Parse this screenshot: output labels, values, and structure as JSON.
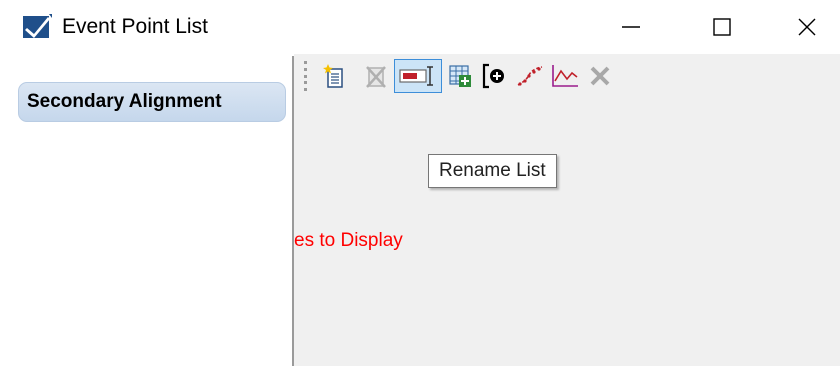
{
  "window": {
    "title": "Event Point List",
    "controls": {
      "minimize_icon": "minimize-icon",
      "maximize_icon": "maximize-icon",
      "close_icon": "close-icon"
    }
  },
  "sidebar": {
    "items": [
      {
        "label": "Secondary Alignment",
        "selected": true
      }
    ]
  },
  "toolbar": {
    "buttons": [
      {
        "icon": "new-list-icon",
        "enabled": true
      },
      {
        "icon": "delete-list-icon",
        "enabled": false
      },
      {
        "icon": "rename-list-icon",
        "enabled": true,
        "active": true
      },
      {
        "icon": "table-add-icon",
        "enabled": true
      },
      {
        "icon": "add-point-icon",
        "enabled": true
      },
      {
        "icon": "points-along-icon",
        "enabled": true
      },
      {
        "icon": "profile-icon",
        "enabled": true
      },
      {
        "icon": "delete-icon",
        "enabled": false
      }
    ]
  },
  "tooltip": {
    "text": "Rename List"
  },
  "main": {
    "message": "es to Display",
    "message_color": "#ff0000"
  },
  "colors": {
    "accent": "#3d8ed9",
    "sidebar_tab": "#c5d7ec",
    "content_bg": "#f0f0f0"
  }
}
